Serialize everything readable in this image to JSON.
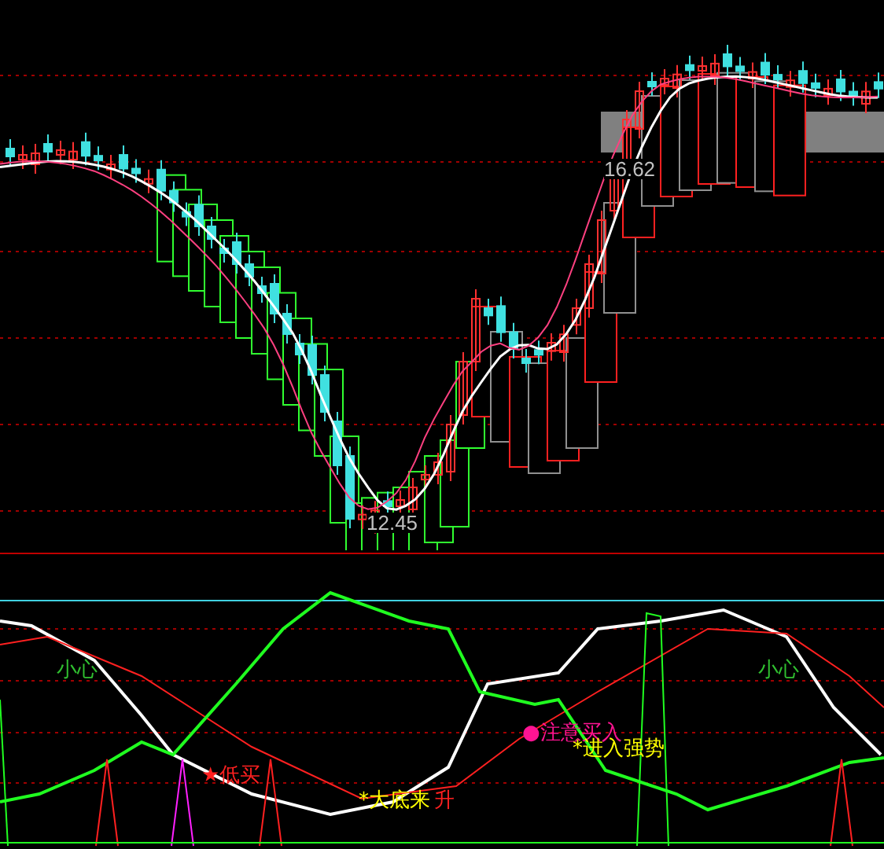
{
  "main_chart": {
    "high_label": "16.62",
    "low_label": "12.45"
  },
  "indicator": {
    "labels": [
      {
        "text": "小心",
        "color": "#30c030"
      },
      {
        "text": "★低买",
        "color": "#ff2020"
      },
      {
        "text": "*大底来",
        "color": "#ffff00"
      },
      {
        "text": "升",
        "color": "#ff2020"
      },
      {
        "text": "●注意买入",
        "color": "#ff1493"
      },
      {
        "text": "*进入强势",
        "color": "#ffff00"
      },
      {
        "text": "小心",
        "color": "#30c030"
      }
    ]
  }
}
